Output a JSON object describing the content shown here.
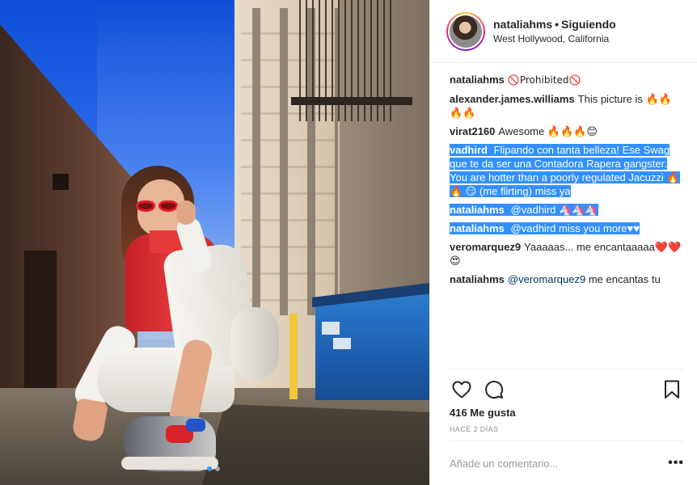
{
  "header": {
    "username": "nataliahms",
    "separator": "•",
    "follow_status": "Siguiendo",
    "location": "West Hollywood, California"
  },
  "comments": [
    {
      "user": "nataliahms",
      "text": "🚫Prohibited🚫"
    },
    {
      "user": "alexander.james.williams",
      "text": "This picture is 🔥🔥🔥🔥"
    },
    {
      "user": "virat2160",
      "text": "Awesome 🔥🔥🔥😊"
    },
    {
      "user": "vadhird",
      "text": "Flipando con tanta belleza! Ese Swag que te da ser una Contadora Rapera gangster. You are hotter than a poorly regulated Jacuzzi 🔥🔥 😏 (me flirting) miss ya",
      "selected": true
    },
    {
      "user": "nataliahms",
      "mention": "@vadhird",
      "text": "🦄🦄🦄",
      "selected": true
    },
    {
      "user": "nataliahms",
      "mention": "@vadhird",
      "text": "miss you more♥♥",
      "selected": true
    },
    {
      "user": "veromarquez9",
      "text": "Yaaaaas... me encantaaaaa❤️❤️😍"
    },
    {
      "user": "nataliahms",
      "mention": "@veromarquez9",
      "text": "me encantas tu"
    }
  ],
  "actions": {
    "like_icon": "heart-icon",
    "comment_icon": "comment-icon",
    "save_icon": "bookmark-icon",
    "likes": "416 Me gusta",
    "time": "HACE 2 DÍAS"
  },
  "add_comment": {
    "placeholder": "Añade un comentario...",
    "more": "•••"
  },
  "carousel": {
    "count": 2,
    "active": 1
  },
  "colors": {
    "selection": "#3390ff",
    "link": "#003569",
    "muted": "#8e8e8e"
  }
}
